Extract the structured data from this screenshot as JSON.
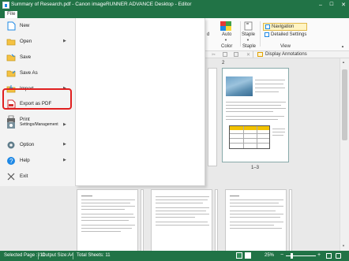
{
  "window": {
    "title": "Summary of Research.pdf - Canon imageRUNNER ADVANCE Desktop - Editor",
    "controls": [
      "–",
      "☐",
      "✕"
    ]
  },
  "ribbon": {
    "file_tab": "File",
    "partial_label": "d",
    "auto_label": "Auto",
    "staple_label": "Staple",
    "color_group": "Color",
    "staple_group": "Staple",
    "view_group": "View",
    "navigation_label": "Navigation",
    "detailed_settings_label": "Detailed Settings",
    "display_annotations_label": "Display Annotations"
  },
  "file_menu": {
    "items": [
      {
        "label": "New",
        "icon": "new-document-icon",
        "arrow": ""
      },
      {
        "label": "Open",
        "icon": "open-folder-icon",
        "arrow": "▶"
      },
      {
        "label": "Save",
        "icon": "save-icon",
        "arrow": ""
      },
      {
        "label": "Save As",
        "icon": "save-as-icon",
        "arrow": ""
      },
      {
        "label": "Import",
        "icon": "import-icon",
        "arrow": "▶"
      },
      {
        "label": "Export as PDF",
        "icon": "export-pdf-icon",
        "arrow": ""
      },
      {
        "label": "Print",
        "icon": "print-icon",
        "arrow": ""
      },
      {
        "label": "Settings/Management",
        "icon": "settings-management-icon",
        "arrow": "▶"
      },
      {
        "label": "Option",
        "icon": "option-gear-icon",
        "arrow": "▶"
      },
      {
        "label": "Help",
        "icon": "help-icon",
        "arrow": "▶"
      },
      {
        "label": "Exit",
        "icon": "exit-icon",
        "arrow": ""
      }
    ],
    "highlighted_item": "Export as PDF"
  },
  "workspace": {
    "page_number_top": "2",
    "page_range": "1–3"
  },
  "status": {
    "selected_page": "Selected Page : /11",
    "output_size": "Output Size:A4",
    "total_sheets": "Total Sheets: 11",
    "zoom": "25%",
    "zoom_minus": "−",
    "zoom_plus": "+"
  },
  "colors": {
    "title_bar": "#217346",
    "highlight": "#e02020",
    "navigation_active": "#fff4c2"
  }
}
